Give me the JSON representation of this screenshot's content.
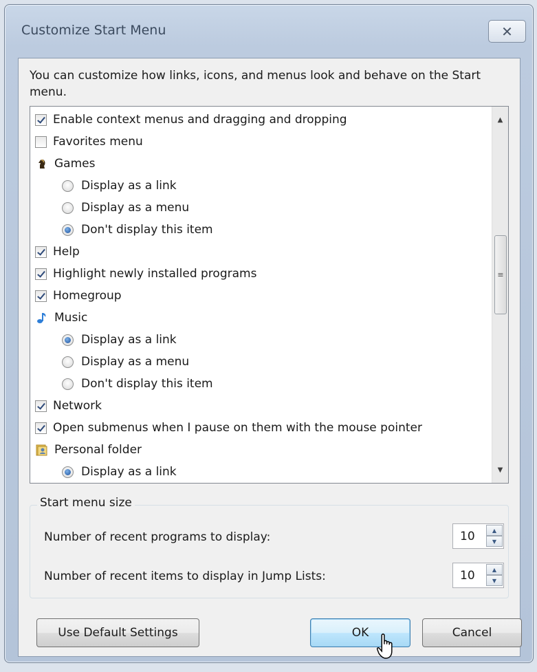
{
  "dialog": {
    "title": "Customize Start Menu",
    "close_glyph": "✕",
    "intro": "You can customize how links, icons, and menus look and behave on the Start menu."
  },
  "options": [
    {
      "kind": "check",
      "checked": true,
      "label": "Enable context menus and dragging and dropping"
    },
    {
      "kind": "check",
      "checked": false,
      "label": "Favorites menu"
    },
    {
      "kind": "header",
      "icon": "games-icon",
      "label": "Games"
    },
    {
      "kind": "radio",
      "selected": false,
      "label": "Display as a link"
    },
    {
      "kind": "radio",
      "selected": false,
      "label": "Display as a menu"
    },
    {
      "kind": "radio",
      "selected": true,
      "label": "Don't display this item"
    },
    {
      "kind": "check",
      "checked": true,
      "label": "Help"
    },
    {
      "kind": "check",
      "checked": true,
      "label": "Highlight newly installed programs"
    },
    {
      "kind": "check",
      "checked": true,
      "label": "Homegroup"
    },
    {
      "kind": "header",
      "icon": "music-note-icon",
      "label": "Music"
    },
    {
      "kind": "radio",
      "selected": true,
      "label": "Display as a link"
    },
    {
      "kind": "radio",
      "selected": false,
      "label": "Display as a menu"
    },
    {
      "kind": "radio",
      "selected": false,
      "label": "Don't display this item"
    },
    {
      "kind": "check",
      "checked": true,
      "label": "Network"
    },
    {
      "kind": "check",
      "checked": true,
      "label": "Open submenus when I pause on them with the mouse pointer"
    },
    {
      "kind": "header",
      "icon": "personal-folder-icon",
      "label": "Personal folder"
    },
    {
      "kind": "radio",
      "selected": true,
      "label": "Display as a link"
    }
  ],
  "size_group": {
    "label": "Start menu size",
    "recent_programs_label": "Number of recent programs to display:",
    "recent_programs_value": "10",
    "jump_list_label": "Number of recent items to display in Jump Lists:",
    "jump_list_value": "10"
  },
  "buttons": {
    "defaults": "Use Default Settings",
    "ok": "OK",
    "cancel": "Cancel"
  },
  "colors": {
    "accent": "#3c7fb1",
    "frame": "#bccbdf"
  }
}
